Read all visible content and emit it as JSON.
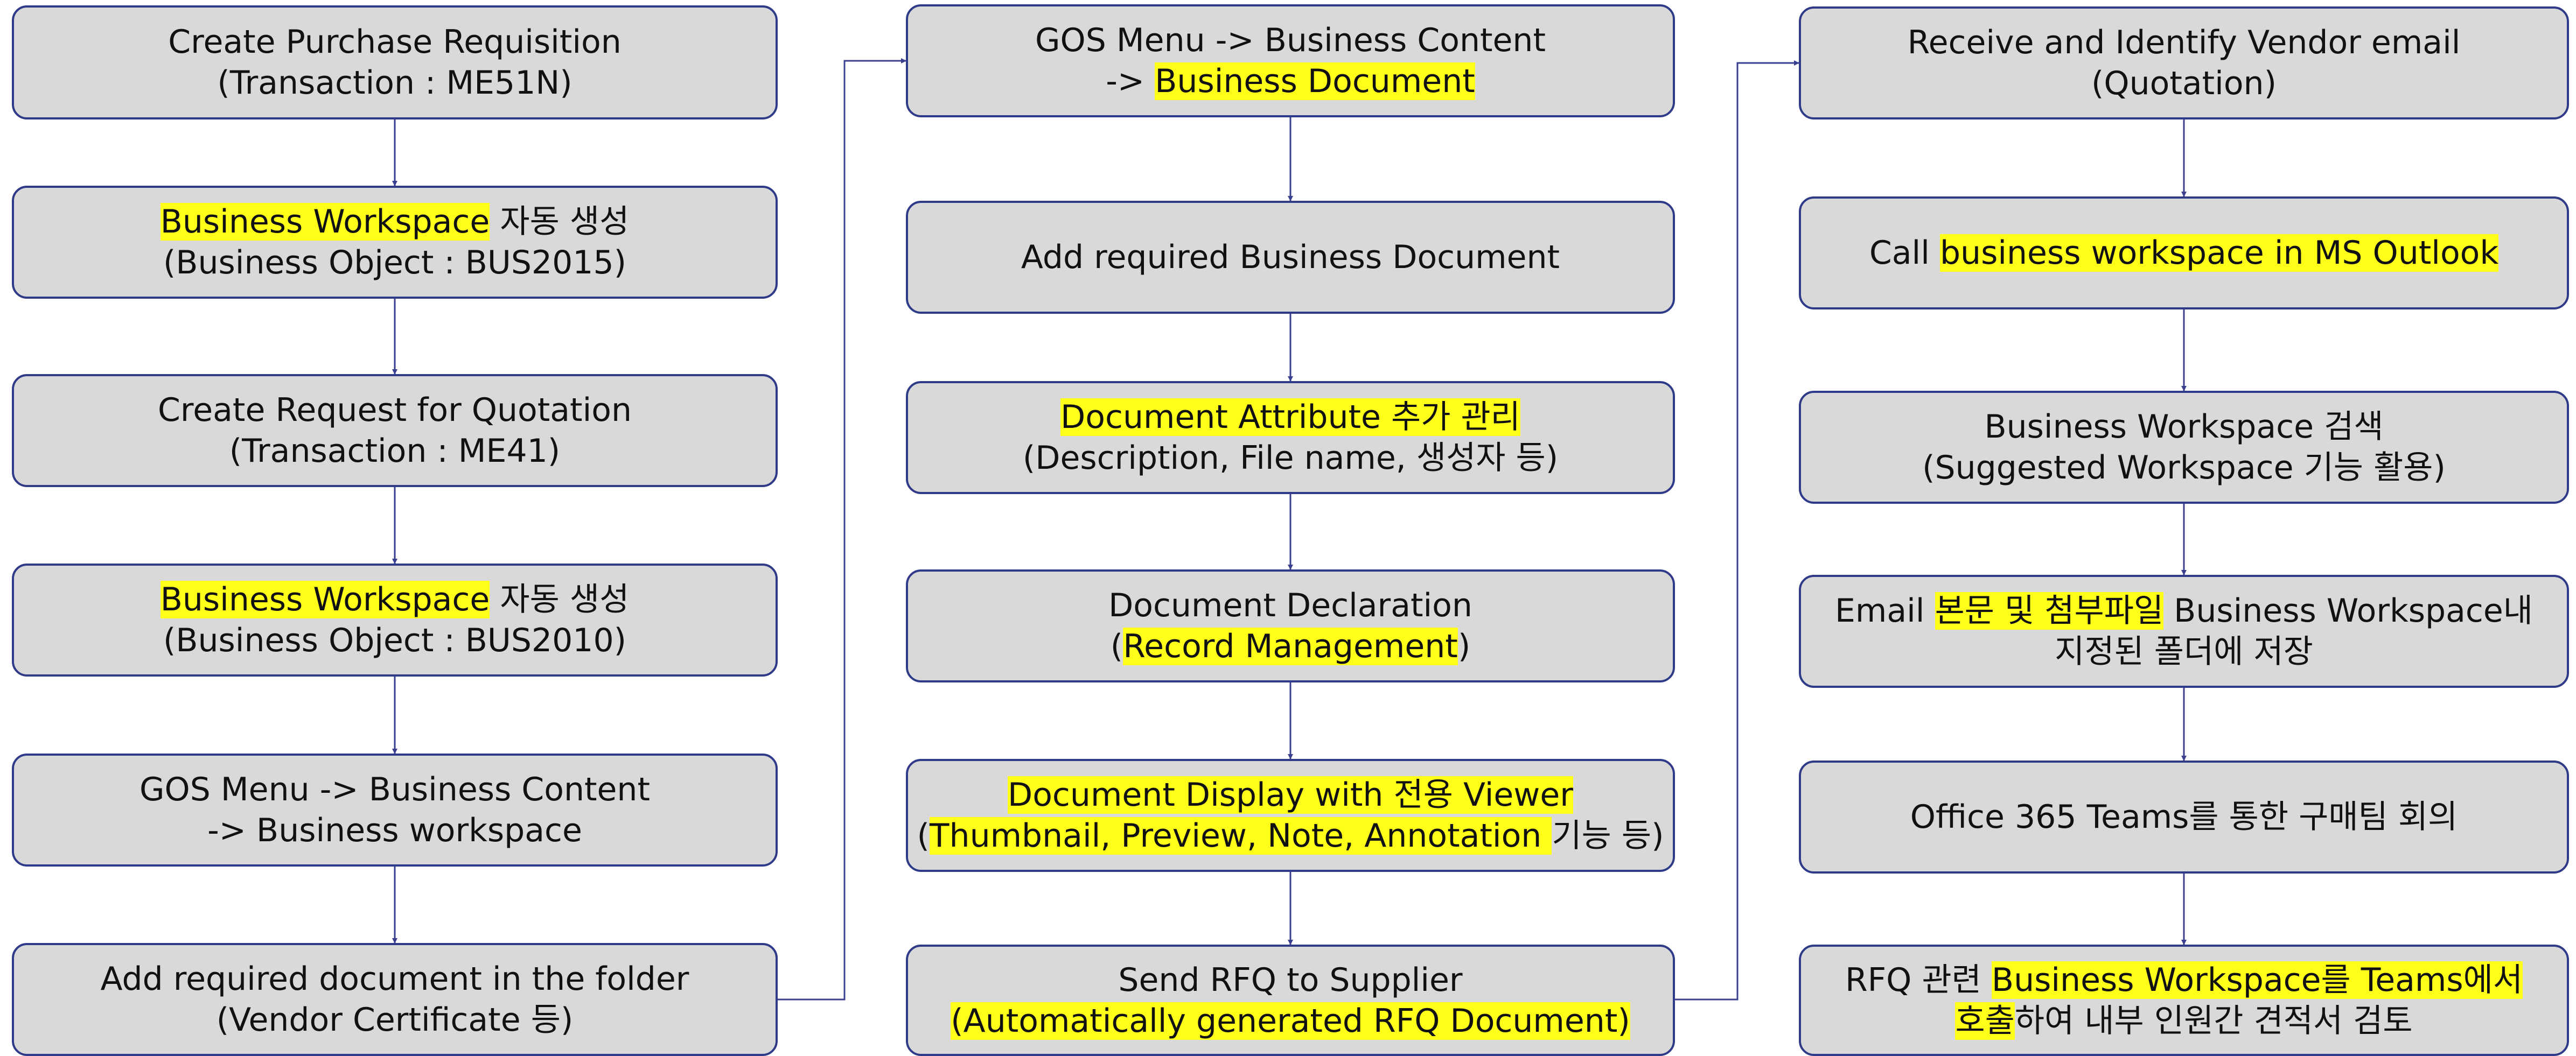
{
  "columns": [
    {
      "boxes": [
        {
          "lines": [
            [
              {
                "t": "Create Purchase Requisition"
              }
            ],
            [
              {
                "t": "(Transaction : ME51N)"
              }
            ]
          ]
        },
        {
          "lines": [
            [
              {
                "t": "Business Workspace",
                "hl": true
              },
              {
                "t": " 자동 생성"
              }
            ],
            [
              {
                "t": "(Business Object : BUS2015)"
              }
            ]
          ]
        },
        {
          "lines": [
            [
              {
                "t": "Create Request for Quotation"
              }
            ],
            [
              {
                "t": "(Transaction : ME41)"
              }
            ]
          ]
        },
        {
          "lines": [
            [
              {
                "t": "Business Workspace",
                "hl": true
              },
              {
                "t": " 자동 생성"
              }
            ],
            [
              {
                "t": "(Business Object : BUS2010)"
              }
            ]
          ]
        },
        {
          "lines": [
            [
              {
                "t": "GOS Menu -> Business Content"
              }
            ],
            [
              {
                "t": "-> Business workspace"
              }
            ]
          ]
        },
        {
          "lines": [
            [
              {
                "t": "Add required document in the folder"
              }
            ],
            [
              {
                "t": "(Vendor Certificate 등)"
              }
            ]
          ]
        }
      ]
    },
    {
      "boxes": [
        {
          "lines": [
            [
              {
                "t": "GOS Menu -> Business Content"
              }
            ],
            [
              {
                "t": "-> "
              },
              {
                "t": "Business Document",
                "hl": true
              }
            ]
          ]
        },
        {
          "lines": [
            [
              {
                "t": "Add required Business Document"
              }
            ]
          ]
        },
        {
          "lines": [
            [
              {
                "t": "Document Attribute 추가 관리",
                "hl": true
              }
            ],
            [
              {
                "t": "(Description, File name, 생성자 등)"
              }
            ]
          ]
        },
        {
          "lines": [
            [
              {
                "t": "Document Declaration"
              }
            ],
            [
              {
                "t": "("
              },
              {
                "t": "Record Management",
                "hl": true
              },
              {
                "t": ")"
              }
            ]
          ]
        },
        {
          "lines": [
            [
              {
                "t": "Document Display with 전용 Viewer",
                "hl": true
              }
            ],
            [
              {
                "t": "("
              },
              {
                "t": "Thumbnail, Preview, Note, Annotation ",
                "hl": true
              },
              {
                "t": "기능 등)"
              }
            ]
          ]
        },
        {
          "lines": [
            [
              {
                "t": "Send RFQ to Supplier"
              }
            ],
            [
              {
                "t": "(Automatically generated RFQ Document)",
                "hl": true
              }
            ]
          ]
        }
      ]
    },
    {
      "boxes": [
        {
          "lines": [
            [
              {
                "t": "Receive and Identify Vendor email"
              }
            ],
            [
              {
                "t": "(Quotation)"
              }
            ]
          ]
        },
        {
          "lines": [
            [
              {
                "t": "Call "
              },
              {
                "t": "business workspace in MS Outlook",
                "hl": true
              }
            ]
          ]
        },
        {
          "lines": [
            [
              {
                "t": "Business Workspace 검색"
              }
            ],
            [
              {
                "t": "(Suggested Workspace 기능 활용)"
              }
            ]
          ]
        },
        {
          "lines": [
            [
              {
                "t": "Email "
              },
              {
                "t": "본문 및 첨부파일",
                "hl": true
              },
              {
                "t": " Business Workspace내"
              }
            ],
            [
              {
                "t": "지정된 폴더에 저장"
              }
            ]
          ]
        },
        {
          "lines": [
            [
              {
                "t": "Office 365 Teams를 통한 구매팀 회의"
              }
            ]
          ]
        },
        {
          "lines": [
            [
              {
                "t": "RFQ 관련 "
              },
              {
                "t": "Business Workspace를 Teams에서",
                "hl": true
              }
            ],
            [
              {
                "t": "호출",
                "hl": true
              },
              {
                "t": "하여 내부 인원간 견적서 검토"
              }
            ]
          ]
        }
      ]
    }
  ],
  "colors": {
    "box_fill": "#d9d9d9",
    "box_border": "#2f3a88",
    "connector": "#3a3f8f",
    "highlight": "#ffff1a",
    "text": "#111111"
  }
}
